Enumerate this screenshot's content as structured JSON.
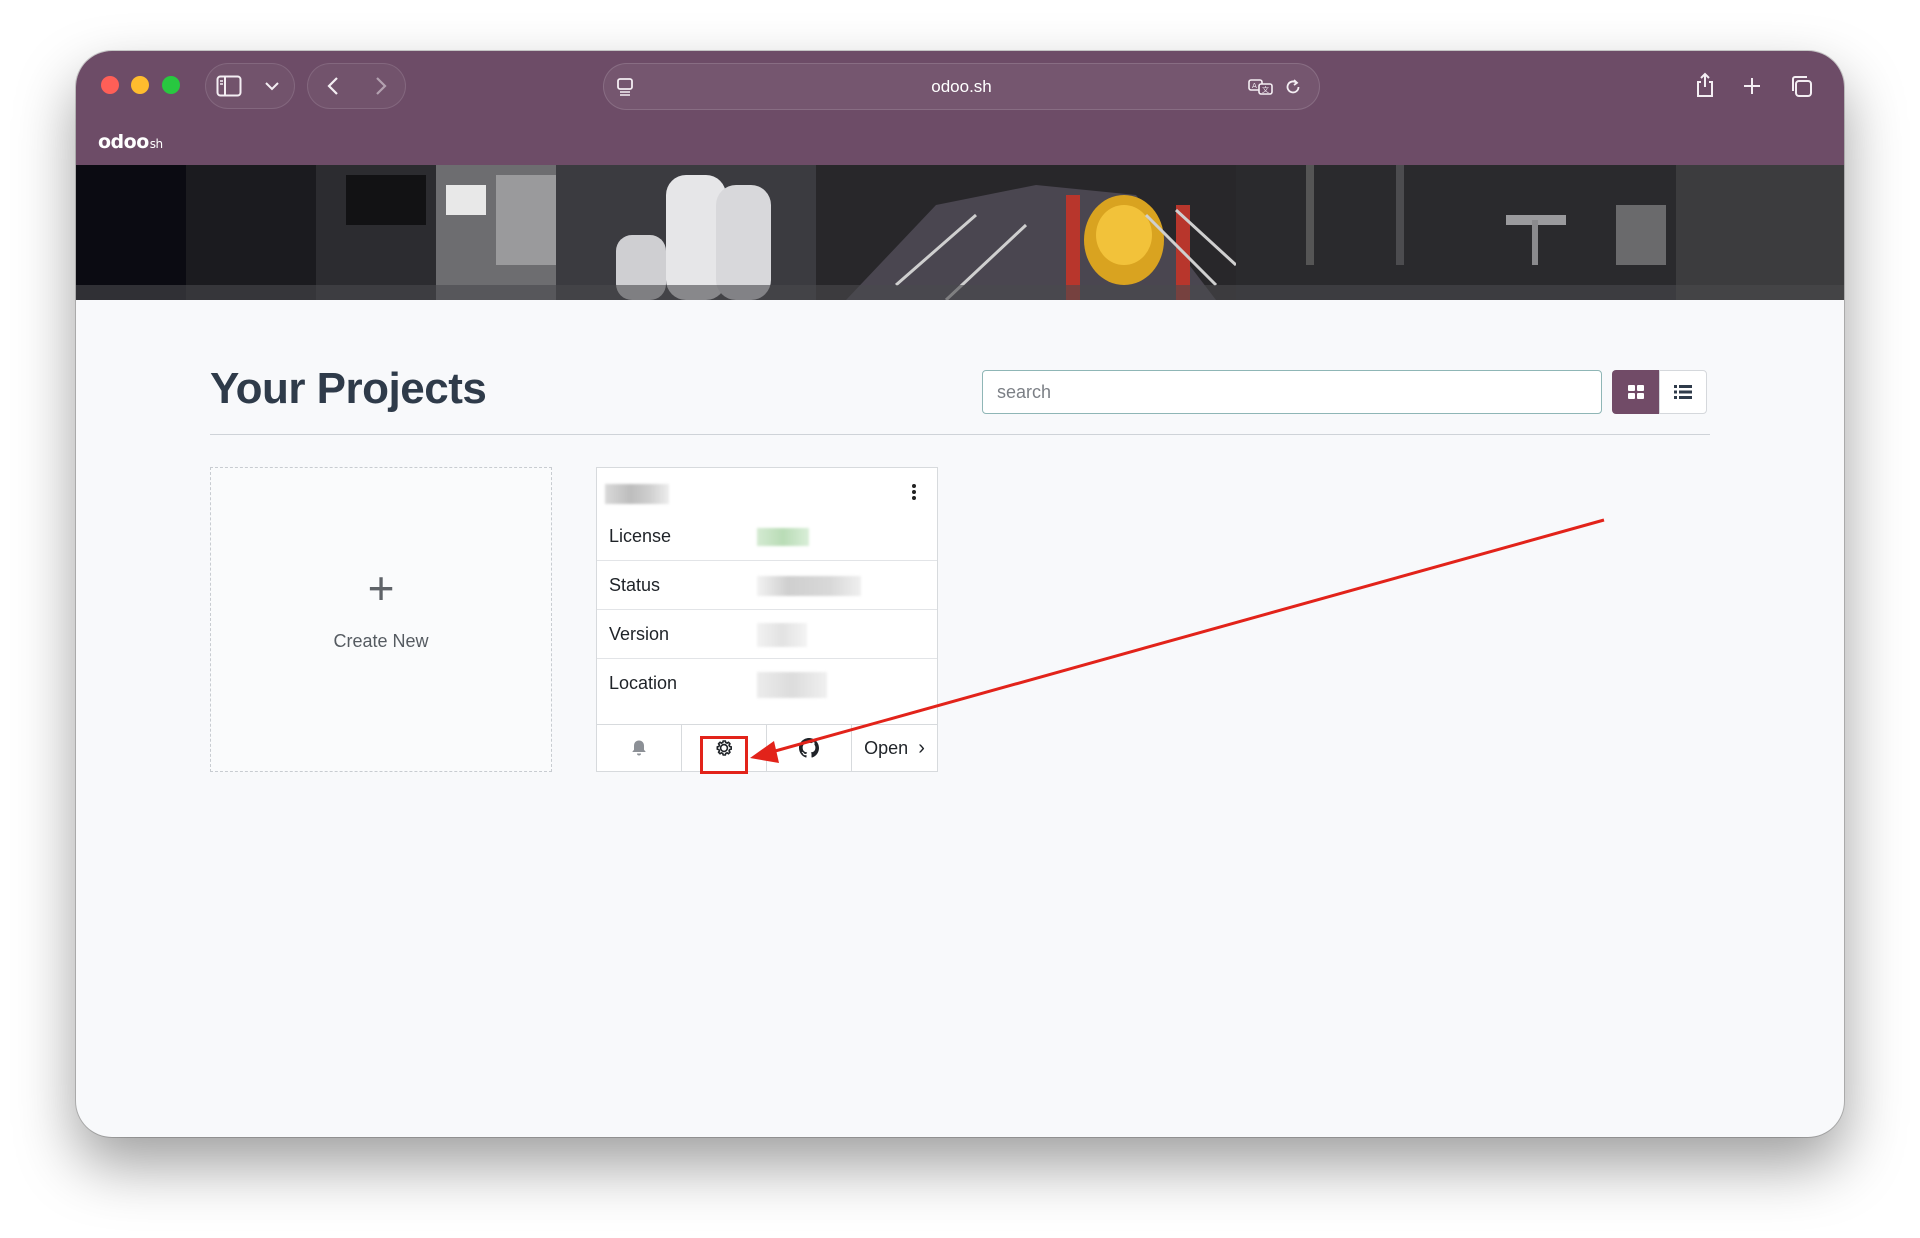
{
  "browser": {
    "url": "odoo.sh",
    "brand_main": "odoo",
    "brand_sub": "sh"
  },
  "page": {
    "title": "Your Projects"
  },
  "search": {
    "placeholder": "search",
    "value": ""
  },
  "view_modes": [
    "grid",
    "list"
  ],
  "create_card": {
    "plus": "+",
    "label": "Create New"
  },
  "project_card": {
    "rows": [
      {
        "label": "License"
      },
      {
        "label": "Status"
      },
      {
        "label": "Version"
      },
      {
        "label": "Location"
      }
    ],
    "footer": {
      "open_label": "Open",
      "open_chevron": "›"
    }
  },
  "colors": {
    "titlebar": "#6d4c67",
    "accent": "#714b67",
    "annotation": "#e2231a"
  },
  "icons": [
    "sidebar-icon",
    "chevron-down-icon",
    "back-icon",
    "forward-icon",
    "page-icon",
    "translate-icon",
    "reload-icon",
    "share-icon",
    "new-tab-icon",
    "tabs-icon",
    "grid-view-icon",
    "list-view-icon",
    "kebab-menu-icon",
    "bell-icon",
    "gear-icon",
    "github-icon"
  ]
}
